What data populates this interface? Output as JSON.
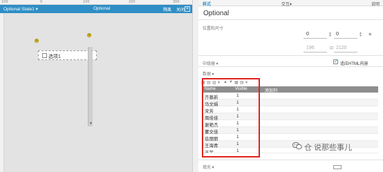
{
  "ruler": {
    "ticks": [
      "100",
      "0",
      "100",
      "200",
      "300"
    ]
  },
  "editor_tab": {
    "name": "Optional State1 ▾",
    "mode": "Optional",
    "edit_label": "隔离",
    "close_label": "关闭",
    "close_glyph": "✕"
  },
  "canvas": {
    "option_label": "选项1",
    "marker_top": "⊕",
    "marker_left": "⊕",
    "scroll_arrow": "▼"
  },
  "inspector": {
    "tabs": {
      "style": "样式",
      "interaction": "交互▾",
      "notes": "说明"
    },
    "title": "Optional",
    "position_caption": "位置和尺寸",
    "x": "0",
    "y": "0",
    "w": "196",
    "h": "2120",
    "dropdown_caption": "中级器 ▾",
    "html_option": "适应HTML内容",
    "html_checked": true,
    "data_caption": "数据 ▾",
    "toolbar_glyphs": [
      "▦",
      "▤",
      "▥",
      "▾",
      "▲",
      "▼",
      "▦",
      "▤",
      "▾"
    ],
    "fill_caption": "填充 ▾"
  },
  "grid": {
    "headers": [
      "Name",
      "Visible",
      "添加列"
    ],
    "rows": [
      {
        "name": "齐慕新",
        "visible": "1"
      },
      {
        "name": "马文娟",
        "visible": "1"
      },
      {
        "name": "宋芳",
        "visible": "1"
      },
      {
        "name": "周佳佳",
        "visible": "1"
      },
      {
        "name": "谢艳杰",
        "visible": "1"
      },
      {
        "name": "董文佳",
        "visible": "1"
      },
      {
        "name": "岳丽丽",
        "visible": "1"
      },
      {
        "name": "王海青",
        "visible": "1"
      },
      {
        "name": "王菲",
        "visible": "1"
      }
    ]
  },
  "watermark": {
    "text": "仓 说那些事儿"
  },
  "colors": {
    "accent": "#2f8ec5",
    "highlight": "#e0211b",
    "grid_header": "#8e8e8e"
  }
}
